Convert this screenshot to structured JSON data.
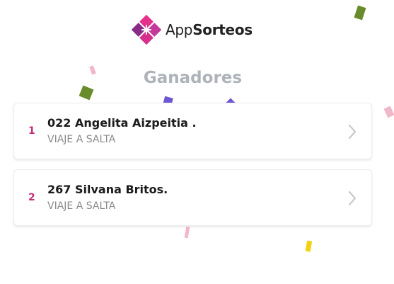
{
  "brand": {
    "name_light": "App",
    "name_bold": "Sorteos",
    "logo_icon": "diamond-logo-icon",
    "colors": {
      "magenta": "#e4318e",
      "purple": "#8a2a88"
    }
  },
  "section": {
    "title": "Ganadores"
  },
  "winners": [
    {
      "rank": "1",
      "name": "022 Angelita Aizpeitia .",
      "prize": "VIAJE A SALTA"
    },
    {
      "rank": "2",
      "name": "267 Silvana Britos.",
      "prize": "VIAJE A SALTA"
    }
  ],
  "icons": {
    "row_action": "chevron-right-icon"
  },
  "colors": {
    "rank": "#c2307e",
    "title": "#aeb2b9",
    "confetti": [
      "#6a8b2c",
      "#6f57d3",
      "#f2b7c8",
      "#f2d10f"
    ]
  }
}
